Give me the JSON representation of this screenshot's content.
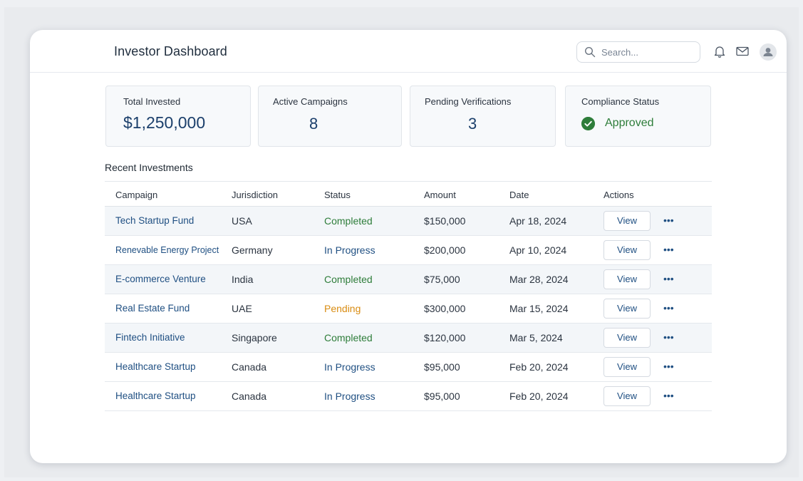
{
  "header": {
    "title": "Investor Dashboard",
    "search_placeholder": "Search..."
  },
  "icons": [
    "search-icon",
    "bell-icon",
    "mail-icon",
    "user-avatar-icon",
    "check-circle-icon",
    "more-icon"
  ],
  "colors": {
    "primary": "#1f4f82",
    "completed": "#2e7d3a",
    "pending": "#d98c12"
  },
  "cards": {
    "total_invested": {
      "label": "Total Invested",
      "value": "$1,250,000"
    },
    "active_campaigns": {
      "label": "Active Campaigns",
      "value": "8"
    },
    "pending_verifications": {
      "label": "Pending Verifications",
      "value": "3"
    },
    "compliance_status": {
      "label": "Compliance Status",
      "value": "Approved"
    }
  },
  "recent": {
    "title": "Recent Investments",
    "columns": [
      "Campaign",
      "Jurisdiction",
      "Status",
      "Amount",
      "Date",
      "Actions"
    ],
    "action_label": "View",
    "more_label": "•••",
    "rows": [
      {
        "campaign": "Tech Startup Fund",
        "jurisdiction": "USA",
        "status": "Completed",
        "amount": "$150,000",
        "date": "Apr 18, 2024"
      },
      {
        "campaign": "Renevable Energy Project",
        "jurisdiction": "Germany",
        "status": "In Progress",
        "amount": "$200,000",
        "date": "Apr 10, 2024"
      },
      {
        "campaign": "E-commerce Venture",
        "jurisdiction": "India",
        "status": "Completed",
        "amount": "$75,000",
        "date": "Mar 28, 2024"
      },
      {
        "campaign": "Real Estate Fund",
        "jurisdiction": "UAE",
        "status": "Pending",
        "amount": "$300,000",
        "date": "Mar 15, 2024"
      },
      {
        "campaign": "Fintech Initiative",
        "jurisdiction": "Singapore",
        "status": "Completed",
        "amount": "$120,000",
        "date": "Mar 5, 2024"
      },
      {
        "campaign": "Healthcare Startup",
        "jurisdiction": "Canada",
        "status": "In Progress",
        "amount": "$95,000",
        "date": "Feb 20, 2024"
      },
      {
        "campaign": "Healthcare Startup",
        "jurisdiction": "Canada",
        "status": "In Progress",
        "amount": "$95,000",
        "date": "Feb 20, 2024"
      }
    ]
  }
}
